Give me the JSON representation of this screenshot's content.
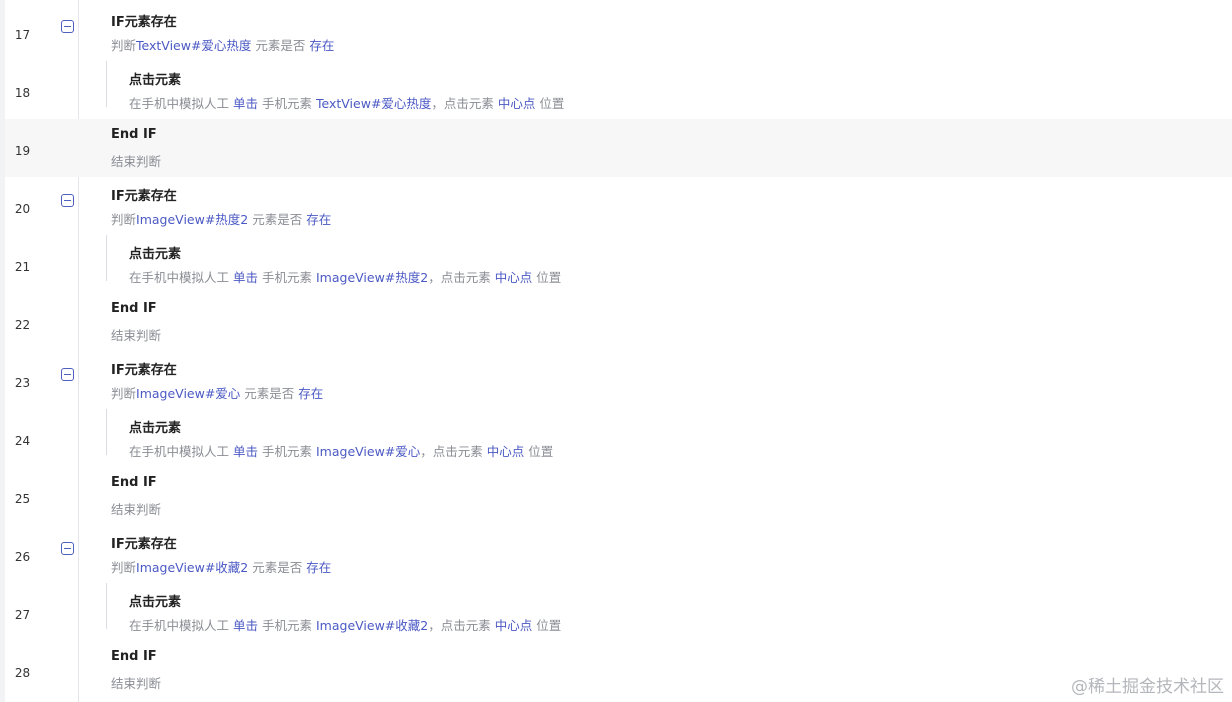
{
  "rows": [
    {
      "line": "17",
      "kind": "if",
      "title": "IF元素存在",
      "d_prefix": "判断",
      "d_target": "TextView#爱心热度",
      "d_mid": "元素是否",
      "d_cond": "存在"
    },
    {
      "line": "18",
      "kind": "click",
      "title": "点击元素",
      "d_prefix": "在手机中模拟人工",
      "d_action": "单击",
      "d_mid": "手机元素",
      "d_target": "TextView#爱心热度",
      "d_mid2": "，点击元素",
      "d_pos": "中心点",
      "d_suffix": "位置"
    },
    {
      "line": "19",
      "kind": "end",
      "title": "End IF",
      "desc": "结束判断",
      "highlighted": true
    },
    {
      "line": "20",
      "kind": "if",
      "title": "IF元素存在",
      "d_prefix": "判断",
      "d_target": "ImageView#热度2",
      "d_mid": "元素是否",
      "d_cond": "存在"
    },
    {
      "line": "21",
      "kind": "click",
      "title": "点击元素",
      "d_prefix": "在手机中模拟人工",
      "d_action": "单击",
      "d_mid": "手机元素",
      "d_target": "ImageView#热度2",
      "d_mid2": "，点击元素",
      "d_pos": "中心点",
      "d_suffix": "位置"
    },
    {
      "line": "22",
      "kind": "end",
      "title": "End IF",
      "desc": "结束判断"
    },
    {
      "line": "23",
      "kind": "if",
      "title": "IF元素存在",
      "d_prefix": "判断",
      "d_target": "ImageView#爱心",
      "d_mid": "元素是否",
      "d_cond": "存在"
    },
    {
      "line": "24",
      "kind": "click",
      "title": "点击元素",
      "d_prefix": "在手机中模拟人工",
      "d_action": "单击",
      "d_mid": "手机元素",
      "d_target": "ImageView#爱心",
      "d_mid2": "，点击元素",
      "d_pos": "中心点",
      "d_suffix": "位置"
    },
    {
      "line": "25",
      "kind": "end",
      "title": "End IF",
      "desc": "结束判断"
    },
    {
      "line": "26",
      "kind": "if",
      "title": "IF元素存在",
      "d_prefix": "判断",
      "d_target": "ImageView#收藏2",
      "d_mid": "元素是否",
      "d_cond": "存在"
    },
    {
      "line": "27",
      "kind": "click",
      "title": "点击元素",
      "d_prefix": "在手机中模拟人工",
      "d_action": "单击",
      "d_mid": "手机元素",
      "d_target": "ImageView#收藏2",
      "d_mid2": "，点击元素",
      "d_pos": "中心点",
      "d_suffix": "位置"
    },
    {
      "line": "28",
      "kind": "end",
      "title": "End IF",
      "desc": "结束判断"
    }
  ],
  "watermark": "@稀土掘金技术社区",
  "colors": {
    "accent": "#4b59c4",
    "muted": "#8a8d94",
    "title": "#222222"
  },
  "icons": {
    "collapse": "collapse-minus-icon"
  }
}
